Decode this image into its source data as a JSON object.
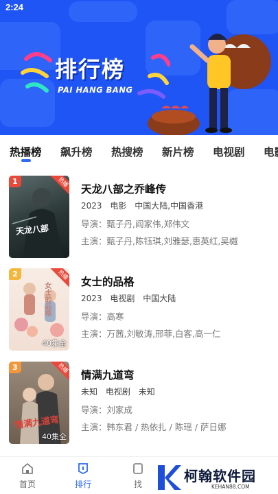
{
  "status_bar": {
    "time": "2:24"
  },
  "banner": {
    "title": "排行榜",
    "subtitle": "PAI HANG BANG"
  },
  "tabs": [
    "热播榜",
    "飙升榜",
    "热搜榜",
    "新片榜",
    "电视剧",
    "电影"
  ],
  "items": [
    {
      "rank": "1",
      "tag": "热播",
      "poster_text": "天龙八部",
      "title": "天龙八部之乔峰传",
      "year": "2023",
      "type": "电影",
      "region": "中国大陆,中国香港",
      "director": "导演：甄子丹,阎家伟,郑伟文",
      "cast": "主演：甄子丹,陈钰琪,刘雅瑟,惠英红,吴樾"
    },
    {
      "rank": "2",
      "tag": "热播",
      "poster_text": "女士的品格",
      "episodes": "40集全",
      "title": "女士的品格",
      "year": "2023",
      "type": "电视剧",
      "region": "中国大陆",
      "director": "导演：高寒",
      "cast": "主演：万茜,刘敏涛,邢菲,白客,高一仁"
    },
    {
      "rank": "3",
      "tag": "热播",
      "poster_text": "情满九道弯",
      "episodes": "40集全",
      "title": "情满九道弯",
      "year": "未知",
      "type": "电视剧",
      "region": "未知",
      "director": "导演：刘家成",
      "cast": "主演：韩东君 / 热依扎 / 陈瑶 / 萨日娜"
    }
  ],
  "bottom_nav": [
    "首页",
    "排行",
    "找"
  ],
  "watermark": {
    "text": "柯翰软件园",
    "url": "KEHAN88.COM"
  },
  "colors": {
    "banner": "#1f55f5",
    "accent": "#2e6bf0",
    "hot_tag": "#e9493b"
  }
}
